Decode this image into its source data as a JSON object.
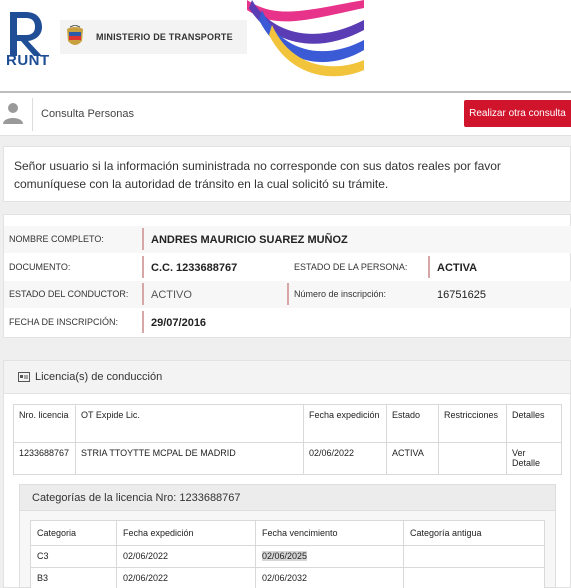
{
  "header": {
    "runt_label": "RUNT",
    "ministry_label": "MINISTERIO DE TRANSPORTE"
  },
  "topbar": {
    "title": "Consulta Personas",
    "button_label": "Realizar otra consulta"
  },
  "notice": {
    "text": "Señor usuario si la información suministrada no corresponde con sus datos reales por favor comuníquese con la autoridad de tránsito en la cual solicitó su trámite."
  },
  "person": {
    "name_label": "NOMBRE COMPLETO:",
    "name_value": "ANDRES MAURICIO SUAREZ MUÑOZ",
    "document_label": "DOCUMENTO:",
    "document_value": "C.C. 1233688767",
    "person_state_label": "ESTADO DE LA PERSONA:",
    "person_state_value": "ACTIVA",
    "driver_state_label": "ESTADO DEL CONDUCTOR:",
    "driver_state_value": "ACTIVO",
    "inscription_number_label": "Número de inscripción:",
    "inscription_number_value": "16751625",
    "inscription_date_label": "FECHA DE INSCRIPCIÓN:",
    "inscription_date_value": "29/07/2016"
  },
  "licenses": {
    "title": "Licencia(s) de conducción",
    "headers": [
      "Nro. licencia",
      "OT Expide Lic.",
      "Fecha expedición",
      "Estado",
      "Restricciones",
      "Detalles"
    ],
    "rows": [
      [
        "1233688767",
        "STRIA TTOYTTE MCPAL DE MADRID",
        "02/06/2022",
        "ACTIVA",
        "",
        "Ver Detalle"
      ]
    ]
  },
  "categories": {
    "title": "Categorías de la licencia Nro: 1233688767",
    "headers": [
      "Categoria",
      "Fecha expedición",
      "Fecha vencimiento",
      "Categoría antigua"
    ],
    "rows": [
      [
        "C3",
        "02/06/2022",
        "02/06/2025",
        ""
      ],
      [
        "B3",
        "02/06/2022",
        "02/06/2032",
        ""
      ]
    ]
  },
  "colors": {
    "accent_red": "#d0142c",
    "runt_blue": "#1f4e96"
  }
}
